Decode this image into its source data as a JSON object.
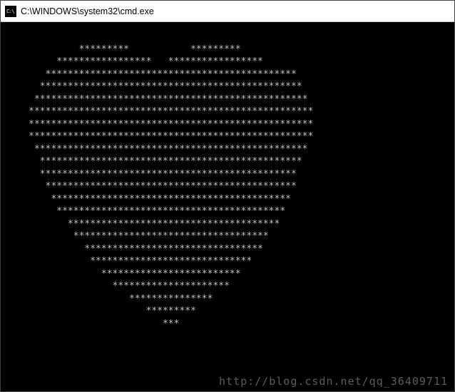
{
  "window": {
    "title": "C:\\WINDOWS\\system32\\cmd.exe",
    "icon_label": "C:\\"
  },
  "terminal": {
    "lines": [
      "              *********           *********",
      "          *****************   *****************",
      "        *********************************************",
      "       ***********************************************",
      "      *************************************************",
      "     ***************************************************",
      "     ***************************************************",
      "     ***************************************************",
      "      *************************************************",
      "       ***********************************************",
      "       **********************************************",
      "        *********************************************",
      "         *******************************************",
      "          *****************************************",
      "            **************************************",
      "             ***********************************",
      "               ********************************",
      "                *****************************",
      "                  *************************",
      "                    *********************",
      "                       ***************",
      "                          *********",
      "                             ***"
    ]
  },
  "watermark": {
    "text": "http://blog.csdn.net/qq_36409711"
  }
}
